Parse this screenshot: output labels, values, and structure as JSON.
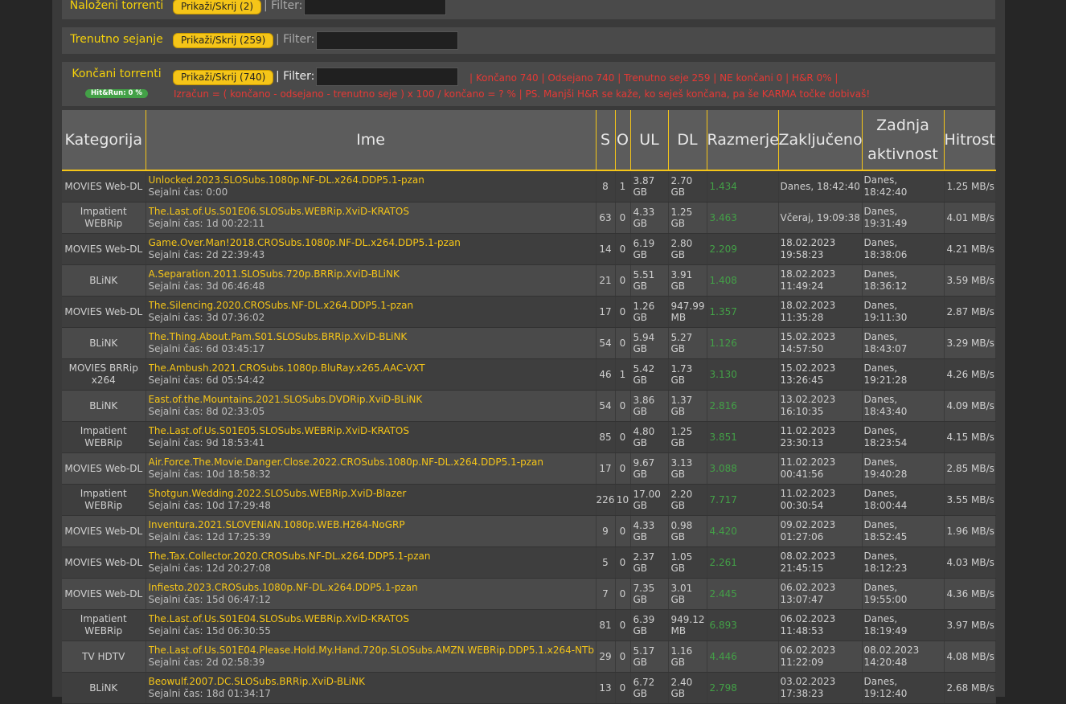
{
  "panels": {
    "loaded": {
      "title": "Naloženi torrenti",
      "button": "Prikaži/Skrij (2)",
      "filter": "| Filter:"
    },
    "seeding": {
      "title": "Trenutno sejanje",
      "button": "Prikaži/Skrij (259)",
      "filter": "| Filter:"
    },
    "completed": {
      "title": "Končani torrenti",
      "button": "Prikaži/Skrij (740)",
      "filter": "| Filter:",
      "badge": "Hit&Run: 0 %",
      "stats": "| Končano 740 | Odsejano 740 | Trenutno seje 259 | NE končani 0 | H&R 0% |",
      "formula": "Izračun = ( končano - odsejano - trenutno seje ) x 100 / končano = ? % | PS. Manjši H&R se kaže, ko seješ končana, pa še KARMA točke dobivaš!"
    }
  },
  "table": {
    "headers": [
      "Kategorija",
      "Ime",
      "S",
      "O",
      "UL",
      "DL",
      "Razmerje",
      "Zaključeno",
      "Zadnja aktivnost",
      "Hitrost"
    ],
    "rows": [
      {
        "cat": "MOVIES Web-DL",
        "name": "Unlocked.2023.SLOSubs.1080p.NF-DL.x264.DDP5.1-pzan",
        "seed": "Sejalni čas: 0:00",
        "s": "8",
        "o": "1",
        "ul1": "3.87",
        "ul2": "GB",
        "dl1": "2.70",
        "dl2": "GB",
        "ratio": "1.434",
        "d1": "Danes, 18:42:40",
        "d2": "",
        "a1": "Danes, 18:42:40",
        "a2": "",
        "speed": "1.25 MB/s"
      },
      {
        "cat": "Impatient WEBRip",
        "name": "The.Last.of.Us.S01E06.SLOSubs.WEBRip.XviD-KRATOS",
        "seed": "Sejalni čas: 1d 00:22:11",
        "s": "63",
        "o": "0",
        "ul1": "4.33",
        "ul2": "GB",
        "dl1": "1.25",
        "dl2": "GB",
        "ratio": "3.463",
        "d1": "Včeraj, 19:09:38",
        "d2": "",
        "a1": "Danes, 19:31:49",
        "a2": "",
        "speed": "4.01 MB/s"
      },
      {
        "cat": "MOVIES Web-DL",
        "name": "Game.Over.Man!2018.CROSubs.1080p.NF-DL.x264.DDP5.1-pzan",
        "seed": "Sejalni čas: 2d 22:39:43",
        "s": "14",
        "o": "0",
        "ul1": "6.19",
        "ul2": "GB",
        "dl1": "2.80",
        "dl2": "GB",
        "ratio": "2.209",
        "d1": "18.02.2023",
        "d2": "19:58:23",
        "a1": "Danes, 18:38:06",
        "a2": "",
        "speed": "4.21 MB/s"
      },
      {
        "cat": "BLiNK",
        "name": "A.Separation.2011.SLOSubs.720p.BRRip.XviD-BLiNK",
        "seed": "Sejalni čas: 3d 06:46:48",
        "s": "21",
        "o": "0",
        "ul1": "5.51",
        "ul2": "GB",
        "dl1": "3.91",
        "dl2": "GB",
        "ratio": "1.408",
        "d1": "18.02.2023",
        "d2": "11:49:24",
        "a1": "Danes, 18:36:12",
        "a2": "",
        "speed": "3.59 MB/s"
      },
      {
        "cat": "MOVIES Web-DL",
        "name": "The.Silencing.2020.CROSubs.NF-DL.x264.DDP5.1-pzan",
        "seed": "Sejalni čas: 3d 07:36:02",
        "s": "17",
        "o": "0",
        "ul1": "1.26",
        "ul2": "GB",
        "dl1": "947.99",
        "dl2": "MB",
        "ratio": "1.357",
        "d1": "18.02.2023",
        "d2": "11:35:28",
        "a1": "Danes, 19:11:30",
        "a2": "",
        "speed": "2.87 MB/s"
      },
      {
        "cat": "BLiNK",
        "name": "The.Thing.About.Pam.S01.SLOSubs.BRRip.XviD-BLiNK",
        "seed": "Sejalni čas: 6d 03:45:17",
        "s": "54",
        "o": "0",
        "ul1": "5.94",
        "ul2": "GB",
        "dl1": "5.27",
        "dl2": "GB",
        "ratio": "1.126",
        "d1": "15.02.2023",
        "d2": "14:57:50",
        "a1": "Danes, 18:43:07",
        "a2": "",
        "speed": "3.29 MB/s"
      },
      {
        "cat": "MOVIES BRRip x264",
        "name": "The.Ambush.2021.CROSubs.1080p.BluRay.x265.AAC-VXT",
        "seed": "Sejalni čas: 6d 05:54:42",
        "s": "46",
        "o": "1",
        "ul1": "5.42",
        "ul2": "GB",
        "dl1": "1.73",
        "dl2": "GB",
        "ratio": "3.130",
        "d1": "15.02.2023",
        "d2": "13:26:45",
        "a1": "Danes, 19:21:28",
        "a2": "",
        "speed": "4.26 MB/s"
      },
      {
        "cat": "BLiNK",
        "name": "East.of.the.Mountains.2021.SLOSubs.DVDRip.XviD-BLiNK",
        "seed": "Sejalni čas: 8d 02:33:05",
        "s": "54",
        "o": "0",
        "ul1": "3.86",
        "ul2": "GB",
        "dl1": "1.37",
        "dl2": "GB",
        "ratio": "2.816",
        "d1": "13.02.2023",
        "d2": "16:10:35",
        "a1": "Danes, 18:43:40",
        "a2": "",
        "speed": "4.09 MB/s"
      },
      {
        "cat": "Impatient WEBRip",
        "name": "The.Last.of.Us.S01E05.SLOSubs.WEBRip.XviD-KRATOS",
        "seed": "Sejalni čas: 9d 18:53:41",
        "s": "85",
        "o": "0",
        "ul1": "4.80",
        "ul2": "GB",
        "dl1": "1.25",
        "dl2": "GB",
        "ratio": "3.851",
        "d1": "11.02.2023",
        "d2": "23:30:13",
        "a1": "Danes, 18:23:54",
        "a2": "",
        "speed": "4.15 MB/s"
      },
      {
        "cat": "MOVIES Web-DL",
        "name": "Air.Force.The.Movie.Danger.Close.2022.CROSubs.1080p.NF-DL.x264.DDP5.1-pzan",
        "seed": "Sejalni čas: 10d 18:58:32",
        "s": "17",
        "o": "0",
        "ul1": "9.67",
        "ul2": "GB",
        "dl1": "3.13",
        "dl2": "GB",
        "ratio": "3.088",
        "d1": "11.02.2023",
        "d2": "00:41:56",
        "a1": "Danes, 19:40:28",
        "a2": "",
        "speed": "2.85 MB/s"
      },
      {
        "cat": "Impatient WEBRip",
        "name": "Shotgun.Wedding.2022.SLOSubs.WEBRip.XviD-Blazer",
        "seed": "Sejalni čas: 10d 17:29:48",
        "s": "226",
        "o": "10",
        "ul1": "17.00",
        "ul2": "GB",
        "dl1": "2.20",
        "dl2": "GB",
        "ratio": "7.717",
        "d1": "11.02.2023",
        "d2": "00:30:54",
        "a1": "Danes, 18:00:44",
        "a2": "",
        "speed": "3.55 MB/s"
      },
      {
        "cat": "MOVIES Web-DL",
        "name": "Inventura.2021.SLOVENiAN.1080p.WEB.H264-NoGRP",
        "seed": "Sejalni čas: 12d 17:25:39",
        "s": "9",
        "o": "0",
        "ul1": "4.33",
        "ul2": "GB",
        "dl1": "0.98",
        "dl2": "GB",
        "ratio": "4.420",
        "d1": "09.02.2023",
        "d2": "01:27:06",
        "a1": "Danes, 18:52:45",
        "a2": "",
        "speed": "1.96 MB/s"
      },
      {
        "cat": "MOVIES Web-DL",
        "name": "The.Tax.Collector.2020.CROSubs.NF-DL.x264.DDP5.1-pzan",
        "seed": "Sejalni čas: 12d 20:27:08",
        "s": "5",
        "o": "0",
        "ul1": "2.37",
        "ul2": "GB",
        "dl1": "1.05",
        "dl2": "GB",
        "ratio": "2.261",
        "d1": "08.02.2023",
        "d2": "21:45:15",
        "a1": "Danes, 18:12:23",
        "a2": "",
        "speed": "4.03 MB/s"
      },
      {
        "cat": "MOVIES Web-DL",
        "name": "Infiesto.2023.CROSubs.1080p.NF-DL.x264.DDP5.1-pzan",
        "seed": "Sejalni čas: 15d 06:47:12",
        "s": "7",
        "o": "0",
        "ul1": "7.35",
        "ul2": "GB",
        "dl1": "3.01",
        "dl2": "GB",
        "ratio": "2.445",
        "d1": "06.02.2023",
        "d2": "13:07:47",
        "a1": "Danes, 19:55:00",
        "a2": "",
        "speed": "4.36 MB/s"
      },
      {
        "cat": "Impatient WEBRip",
        "name": "The.Last.of.Us.S01E04.SLOSubs.WEBRip.XviD-KRATOS",
        "seed": "Sejalni čas: 15d 06:30:55",
        "s": "81",
        "o": "0",
        "ul1": "6.39",
        "ul2": "GB",
        "dl1": "949.12",
        "dl2": "MB",
        "ratio": "6.893",
        "d1": "06.02.2023",
        "d2": "11:48:53",
        "a1": "Danes, 18:19:49",
        "a2": "",
        "speed": "3.97 MB/s"
      },
      {
        "cat": "TV HDTV",
        "name": "The.Last.of.Us.S01E04.Please.Hold.My.Hand.720p.SLOSubs.AMZN.WEBRip.DDP5.1.x264-NTb",
        "seed": "Sejalni čas: 2d 02:58:39",
        "s": "29",
        "o": "0",
        "ul1": "5.17",
        "ul2": "GB",
        "dl1": "1.16",
        "dl2": "GB",
        "ratio": "4.446",
        "d1": "06.02.2023",
        "d2": "11:22:09",
        "a1": "08.02.2023",
        "a2": "14:20:48",
        "speed": "4.08 MB/s"
      },
      {
        "cat": "BLiNK",
        "name": "Beowulf.2007.DC.SLOSubs.BRRip.XviD-BLiNK",
        "seed": "Sejalni čas: 18d 01:34:17",
        "s": "13",
        "o": "0",
        "ul1": "6.72",
        "ul2": "GB",
        "dl1": "2.40",
        "dl2": "GB",
        "ratio": "2.798",
        "d1": "03.02.2023",
        "d2": "17:38:23",
        "a1": "Danes, 19:12:40",
        "a2": "",
        "speed": "2.68 MB/s"
      }
    ]
  }
}
